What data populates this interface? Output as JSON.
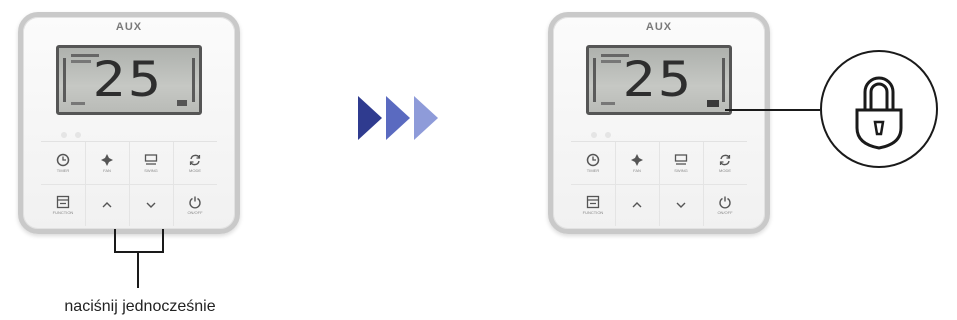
{
  "left_panel": {
    "brand": "AUX",
    "display_temp": "25",
    "buttons": [
      "TIMER",
      "FAN",
      "SWING",
      "MODE",
      "FUNCTION",
      "up",
      "down",
      "ON/OFF"
    ]
  },
  "right_panel": {
    "brand": "AUX",
    "display_temp": "25",
    "buttons": [
      "TIMER",
      "FAN",
      "SWING",
      "MODE",
      "FUNCTION",
      "up",
      "down",
      "ON/OFF"
    ]
  },
  "caption": "naciśnij jednocześnie",
  "icons": {
    "step_arrows": "triple-chevron-icon",
    "lock": "lock-icon"
  },
  "colors": {
    "arrow_dark": "#2f3b8f",
    "arrow_mid": "#5a6ac0",
    "arrow_light": "#8e9bd9",
    "lcd": "#b9bbb7"
  }
}
